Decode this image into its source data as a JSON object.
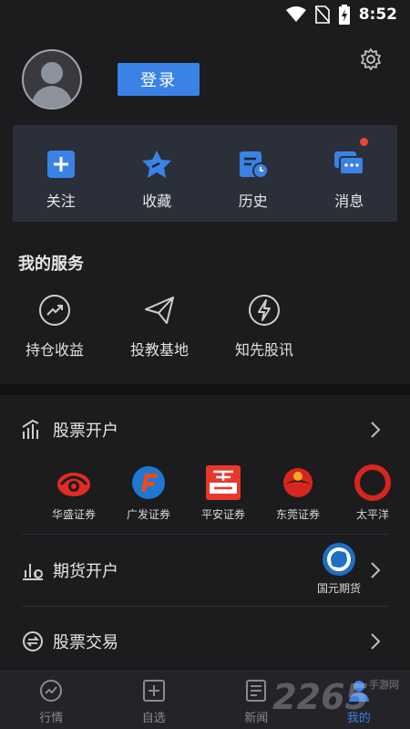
{
  "status_bar": {
    "time": "8:52"
  },
  "header": {
    "login_label": "登录"
  },
  "quick": [
    {
      "label": "关注",
      "icon": "plus-icon"
    },
    {
      "label": "收藏",
      "icon": "star-icon"
    },
    {
      "label": "历史",
      "icon": "history-icon"
    },
    {
      "label": "消息",
      "icon": "message-icon"
    }
  ],
  "services": {
    "title": "我的服务",
    "items": [
      {
        "label": "持仓收益",
        "icon": "trend-icon"
      },
      {
        "label": "投教基地",
        "icon": "paper-plane-icon"
      },
      {
        "label": "知先股讯",
        "icon": "lightning-icon"
      }
    ]
  },
  "stock_open": {
    "title": "股票开户",
    "brokers": [
      {
        "name": "华盛证券"
      },
      {
        "name": "广发证券"
      },
      {
        "name": "平安证券",
        "logo_text": "平安\n证券"
      },
      {
        "name": "东莞证券"
      },
      {
        "name": "太平洋"
      }
    ]
  },
  "futures_open": {
    "title": "期货开户",
    "broker": "国元期货"
  },
  "stock_trade": {
    "title": "股票交易"
  },
  "tabs": [
    {
      "label": "行情",
      "icon": "market-icon"
    },
    {
      "label": "自选",
      "icon": "watchlist-icon"
    },
    {
      "label": "新闻",
      "icon": "news-icon"
    },
    {
      "label": "我的",
      "icon": "profile-icon",
      "active": true
    }
  ],
  "watermark": {
    "text": "2265",
    "sub": "手游网"
  },
  "colors": {
    "accent": "#3b82e6",
    "panel": "#2b2f3a",
    "badge": "#e8463b"
  }
}
